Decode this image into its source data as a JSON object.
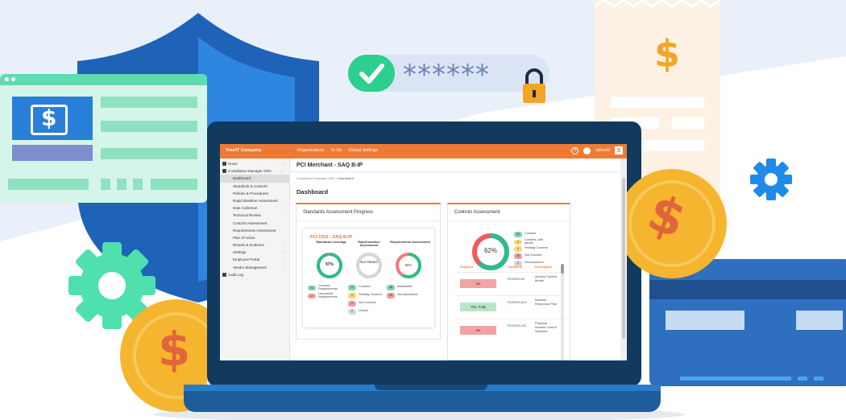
{
  "app": {
    "brand": "YourIT Company",
    "nav": [
      "Organizations",
      "To Do",
      "Global Settings"
    ],
    "help_label": "?",
    "user_label": "edtest3",
    "logout_label": "X"
  },
  "sidebar": {
    "items": [
      {
        "label": "Home",
        "chevron": "›",
        "top": true
      },
      {
        "label": "Compliance Manager GRC",
        "chevron": "⌄",
        "top": true
      },
      {
        "label": "Dashboard",
        "chevron": "",
        "active": true
      },
      {
        "label": "Standards & Controls",
        "chevron": ""
      },
      {
        "label": "Policies & Procedures",
        "chevron": ""
      },
      {
        "label": "Rapid Baseline Assessment",
        "chevron": ""
      },
      {
        "label": "Data Collection",
        "chevron": "›"
      },
      {
        "label": "Technical Review",
        "chevron": ""
      },
      {
        "label": "Controls Assessment",
        "chevron": ""
      },
      {
        "label": "Requirements Assessment",
        "chevron": ""
      },
      {
        "label": "Plan of Action",
        "chevron": ""
      },
      {
        "label": "Results & Evidence",
        "chevron": "›"
      },
      {
        "label": "Settings",
        "chevron": "›"
      },
      {
        "label": "Employee Portal",
        "chevron": "›"
      },
      {
        "label": "Vendor Management",
        "chevron": "›"
      },
      {
        "label": "Audit Log",
        "chevron": "",
        "top": true
      }
    ]
  },
  "page": {
    "title": "PCI Merchant - SAQ B-IP",
    "breadcrumb_parent": "Compliance Manager GRC",
    "breadcrumb_sep": " / ",
    "breadcrumb_current": "Dashboard",
    "dashboard_title": "Dashboard"
  },
  "standards_card": {
    "title": "Standards Assessment Progress",
    "inner_title": "PCI DSS - SAQ B-IP",
    "columns": [
      {
        "head": "Standards Coverage",
        "center": "97%",
        "percent": 97,
        "color": "#2dbd8a"
      },
      {
        "head": "Rapid baseline Assessment",
        "center": "Not Started",
        "percent": 0,
        "color": "#cfcfcf"
      },
      {
        "head": "Requirements Assessment",
        "center": "58%",
        "percent": 58,
        "color": "#2dbd8a"
      }
    ],
    "coverage_legend": [
      {
        "count": "71",
        "label": "Covered Requirements",
        "color": "g"
      },
      {
        "count": "2",
        "label": "Uncovered Requirements",
        "color": "r"
      }
    ],
    "rapid_legend": [
      {
        "count": "0",
        "label": "Covered",
        "color": "g"
      },
      {
        "count": "0",
        "label": "Partially Covered",
        "color": "y"
      },
      {
        "count": "0",
        "label": "Not Covered",
        "color": "r"
      },
      {
        "count": "0",
        "label": "Unsure",
        "color": "grey"
      }
    ],
    "req_legend": [
      {
        "count": "48",
        "label": "Addressed",
        "color": "g"
      },
      {
        "count": "25",
        "label": "Not Addressed",
        "color": "r"
      }
    ]
  },
  "controls_card": {
    "title": "Controls Assessment",
    "percent_label": "62%",
    "percent": 62,
    "legend": [
      {
        "count": "24",
        "label": "Covered",
        "color": "g"
      },
      {
        "count": "0",
        "label": "Covered, with issues",
        "color": "y"
      },
      {
        "count": "0",
        "label": "Partially Covered",
        "color": "y"
      },
      {
        "count": "29",
        "label": "Not Covered",
        "color": "r"
      },
      {
        "count": "0",
        "label": "Not Answered",
        "color": "grey"
      }
    ],
    "table_headers": [
      "Progress",
      "Control ID",
      "Description"
    ],
    "rows": [
      {
        "status": "No",
        "kind": "no",
        "id": "PCIDSS-90",
        "desc": "Access Control Model"
      },
      {
        "status": "Yes, Fully",
        "kind": "yes",
        "id": "PCIDSS-313",
        "desc": "Incident Response Plan"
      },
      {
        "status": "No",
        "kind": "no",
        "id": "PCIDSS-124",
        "desc": "Physical Access Control Systems"
      }
    ]
  },
  "decor": {
    "password_mask": "******",
    "dollar_glyph": "$",
    "colors": {
      "brand_orange": "#ef7a34",
      "navy": "#123a5e",
      "teal": "#5edcb0",
      "gold": "#f5b52e"
    }
  }
}
